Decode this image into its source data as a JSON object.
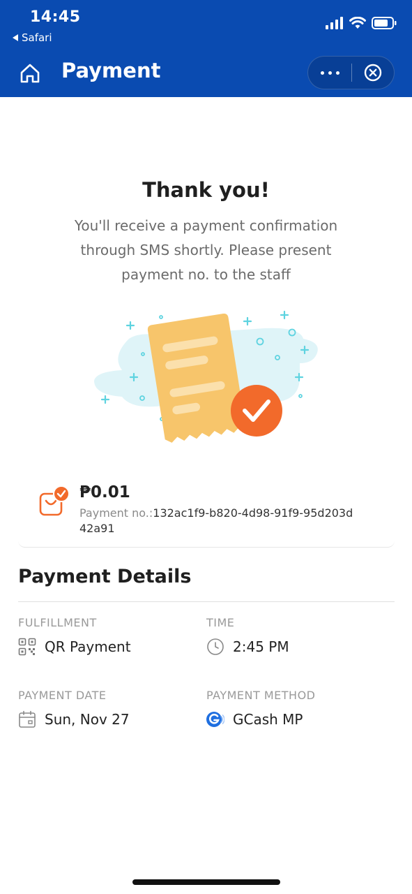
{
  "status_bar": {
    "time": "14:45",
    "back_label": "Safari"
  },
  "nav": {
    "title": "Payment"
  },
  "confirmation": {
    "title": "Thank you!",
    "message": "You'll receive a payment confirmation through SMS shortly. Please present payment no. to the staff"
  },
  "payment": {
    "amount": "₱0.01",
    "payment_no_label": "Payment no.:",
    "payment_no": "132ac1f9-b820-4d98-91f9-95d203d42a91"
  },
  "details": {
    "title": "Payment Details",
    "fulfillment_label": "FULFILLMENT",
    "fulfillment_value": "QR Payment",
    "time_label": "TIME",
    "time_value": "2:45 PM",
    "date_label": "PAYMENT DATE",
    "date_value": "Sun, Nov 27",
    "method_label": "PAYMENT METHOD",
    "method_value": "GCash MP"
  },
  "icons": {
    "home": "home-icon",
    "more": "more-dots-icon",
    "close": "close-circle-icon",
    "qr": "qr-code-icon",
    "clock": "clock-icon",
    "calendar": "calendar-icon",
    "gcash": "gcash-logo-icon"
  },
  "colors": {
    "header_bg": "#0a4bb1",
    "accent_orange": "#f26a2b",
    "receipt_yellow": "#f7c56b"
  }
}
